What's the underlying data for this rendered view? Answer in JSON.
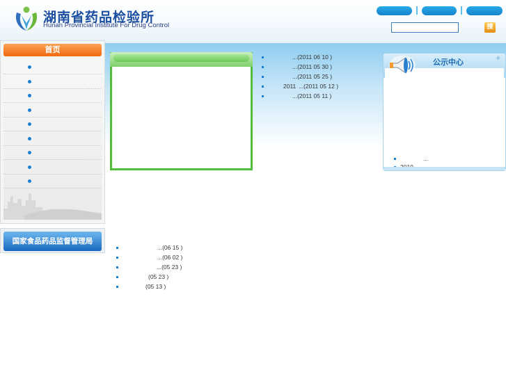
{
  "header": {
    "title_cn": "湖南省药品检验所",
    "title_en": "Hunan Provincial Institute For Drug Control",
    "search_button_label": "搜"
  },
  "left_nav": {
    "home_label": "首页",
    "item_count": 9,
    "sfda_label": "国家食品药品监督管理局"
  },
  "news_top": [
    {
      "prefix": "",
      "date": "...(2011 06 10 )"
    },
    {
      "prefix": "",
      "date": "...(2011 05 30 )"
    },
    {
      "prefix": "",
      "date": "...(2011 05 25 )"
    },
    {
      "prefix": "2011",
      "date": "...(2011 05 12 )"
    },
    {
      "prefix": "",
      "date": "...(2011 05 11 )"
    }
  ],
  "news_bottom": [
    {
      "date": "...(06 15 )"
    },
    {
      "date": "...(06 02 )"
    },
    {
      "date": "...(05 23 )"
    },
    {
      "date": "(05 23 )"
    },
    {
      "date": "(05 13 )"
    }
  ],
  "notice": {
    "title": "公示中心",
    "plus": "+",
    "items": [
      {
        "text": "..."
      },
      {
        "text": "2010"
      }
    ]
  },
  "colors": {
    "accent_blue": "#1a7ed1",
    "nav_orange": "#f2690f",
    "green_border": "#52bd3c"
  }
}
